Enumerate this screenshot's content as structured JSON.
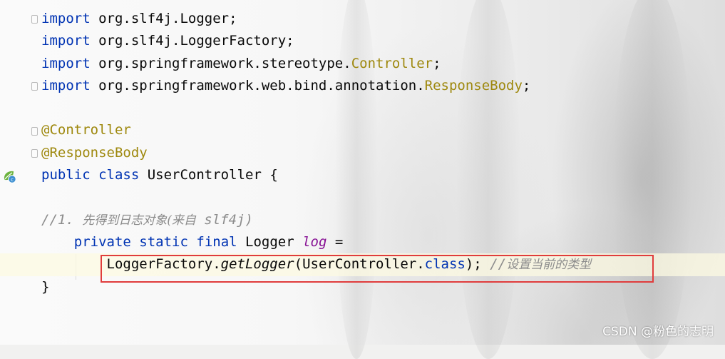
{
  "editor": {
    "lines": [
      {
        "parts": [
          {
            "t": "import",
            "c": "kw"
          },
          {
            "t": " org.slf4j.Logger;"
          }
        ]
      },
      {
        "parts": [
          {
            "t": "import",
            "c": "kw"
          },
          {
            "t": " org.slf4j.LoggerFactory;"
          }
        ]
      },
      {
        "parts": [
          {
            "t": "import",
            "c": "kw"
          },
          {
            "t": " org.springframework.stereotype."
          },
          {
            "t": "Controller",
            "c": "cls"
          },
          {
            "t": ";"
          }
        ]
      },
      {
        "parts": [
          {
            "t": "import",
            "c": "kw"
          },
          {
            "t": " org.springframework.web.bind.annotation."
          },
          {
            "t": "ResponseBody",
            "c": "cls"
          },
          {
            "t": ";"
          }
        ]
      },
      {
        "parts": []
      },
      {
        "parts": [
          {
            "t": "@Controller",
            "c": "ann"
          }
        ]
      },
      {
        "parts": [
          {
            "t": "@ResponseBody",
            "c": "ann"
          }
        ]
      },
      {
        "parts": [
          {
            "t": "public",
            "c": "kw"
          },
          {
            "t": " "
          },
          {
            "t": "class",
            "c": "kw"
          },
          {
            "t": " UserController {"
          }
        ]
      },
      {
        "parts": []
      },
      {
        "parts": [
          {
            "t": "//1. ",
            "c": "cmt"
          },
          {
            "t": "先得到日志对象(来自",
            "c": "cmt cjk"
          },
          {
            "t": " slf4j)",
            "c": "cmt"
          }
        ]
      },
      {
        "parts": [
          {
            "t": "    "
          },
          {
            "t": "private",
            "c": "kw"
          },
          {
            "t": " "
          },
          {
            "t": "static",
            "c": "kw"
          },
          {
            "t": " "
          },
          {
            "t": "final",
            "c": "kw"
          },
          {
            "t": " Logger "
          },
          {
            "t": "log",
            "c": "ivar"
          },
          {
            "t": " ="
          }
        ]
      },
      {
        "parts": [
          {
            "t": "        LoggerFactory."
          },
          {
            "t": "getLogger",
            "c": "it"
          },
          {
            "t": "(UserController."
          },
          {
            "t": "class",
            "c": "kw"
          },
          {
            "t": "); "
          },
          {
            "t": "//",
            "c": "cmt"
          },
          {
            "t": "设置当前的类型",
            "c": "cmt cjk"
          }
        ],
        "current": true
      },
      {
        "parts": [
          {
            "t": "}"
          }
        ]
      }
    ]
  },
  "gutter": {
    "fold_markers": [
      0,
      3,
      5,
      6
    ],
    "class_icon": "spring-class-icon"
  },
  "watermark": {
    "text": "CSDN @粉色的志明"
  }
}
